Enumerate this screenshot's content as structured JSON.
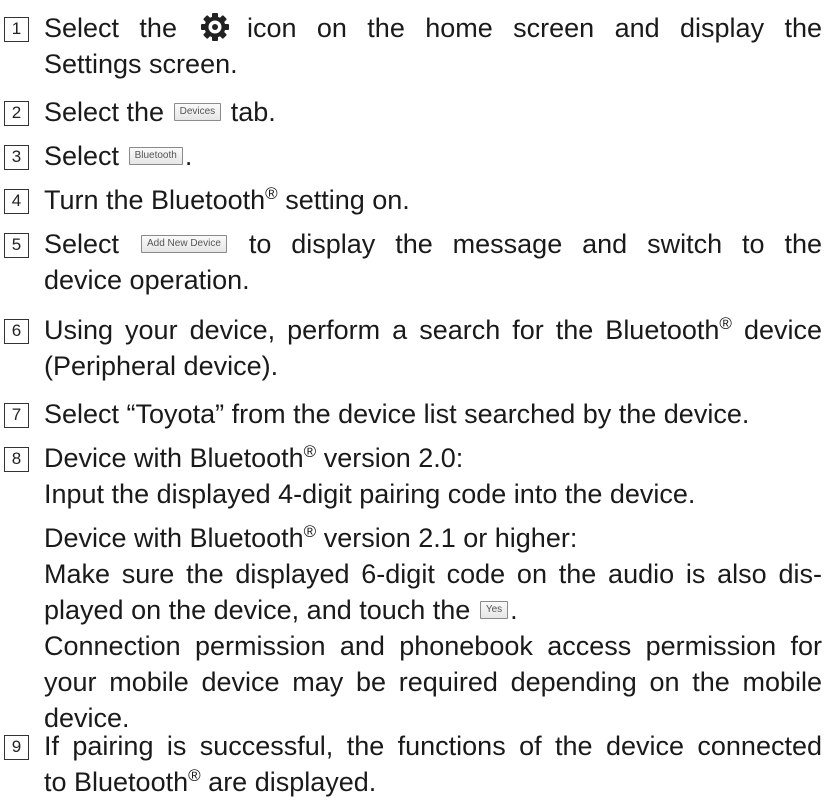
{
  "steps": [
    {
      "num": "1",
      "a": "Select the",
      "icon": "gear-icon",
      "b": "icon on the home screen and display the",
      "c": "Settings screen."
    },
    {
      "num": "2",
      "a": "Select the",
      "button": "Devices",
      "b": "tab."
    },
    {
      "num": "3",
      "a": "Select",
      "button": "Bluetooth",
      "b": "."
    },
    {
      "num": "4",
      "a": "Turn the Bluetooth",
      "reg": "®",
      "b": "setting on."
    },
    {
      "num": "5",
      "a": "Select",
      "button": "Add New Device",
      "b": "to display the message and switch to the",
      "c": "device operation."
    },
    {
      "num": "6",
      "a": "Using your device, perform a search for the Bluetooth",
      "reg": "®",
      "b": "device",
      "c": "(Peripheral device)."
    },
    {
      "num": "7",
      "a": "Select “Toyota” from the device list searched by the device."
    },
    {
      "num": "8",
      "l1a": "Device with Bluetooth",
      "l1reg": "®",
      "l1b": "version 2.0:",
      "l2": "Input the displayed 4-digit pairing code into the device.",
      "l3a": "Device with Bluetooth",
      "l3reg": "®",
      "l3b": "version 2.1 or higher:",
      "l4": "Make sure the displayed 6-digit code on the audio is also dis-",
      "l5a": "played on the device, and touch the",
      "button": "Yes",
      "l5b": ".",
      "l6": "Connection permission and phonebook access permission for",
      "l7": "your mobile device may be required depending on the mobile",
      "l8": "device."
    },
    {
      "num": "9",
      "a": "If pairing is successful, the functions of the device connected",
      "b": "to Bluetooth",
      "reg": "®",
      "c": "are displayed."
    }
  ]
}
